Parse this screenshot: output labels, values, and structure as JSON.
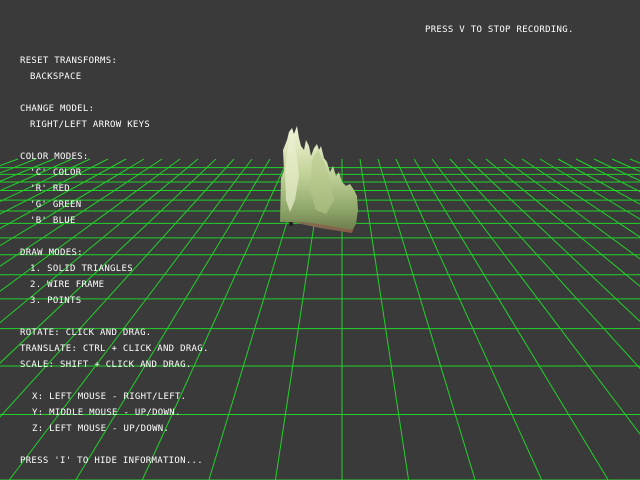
{
  "viewport": {
    "background": "#3a3a3a",
    "grid_color": "#22d12a",
    "recording_notice": "PRESS V TO STOP RECORDING."
  },
  "help": {
    "reset_title": "RESET TRANSFORMS:",
    "reset_key": "BACKSPACE",
    "model_title": "CHANGE MODEL:",
    "model_key": "RIGHT/LEFT ARROW KEYS",
    "color_title": "COLOR MODES:",
    "color_modes": [
      "'C' COLOR",
      "'R' RED",
      "'G' GREEN",
      "'B' BLUE"
    ],
    "draw_title": "DRAW MODES:",
    "draw_modes": [
      "1. SOLID TRIANGLES",
      "2. WIRE FRAME",
      "3. POINTS"
    ],
    "rotate": "ROTATE: CLICK AND DRAG.",
    "translate": "TRANSLATE: CTRL + CLICK AND DRAG.",
    "scale": "SCALE: SHIFT + CLICK AND DRAG.",
    "axes": [
      "X: LEFT MOUSE - RIGHT/LEFT.",
      "Y: MIDDLE MOUSE - UP/DOWN.",
      "Z: LEFT MOUSE - UP/DOWN."
    ],
    "hide_info": "PRESS 'I' TO HIDE INFORMATION..."
  },
  "model": {
    "icon": "terrain-mesh",
    "colors": [
      "#f2f5d8",
      "#c9d9a0",
      "#9db574",
      "#6f8a4f",
      "#7a5a45"
    ]
  }
}
